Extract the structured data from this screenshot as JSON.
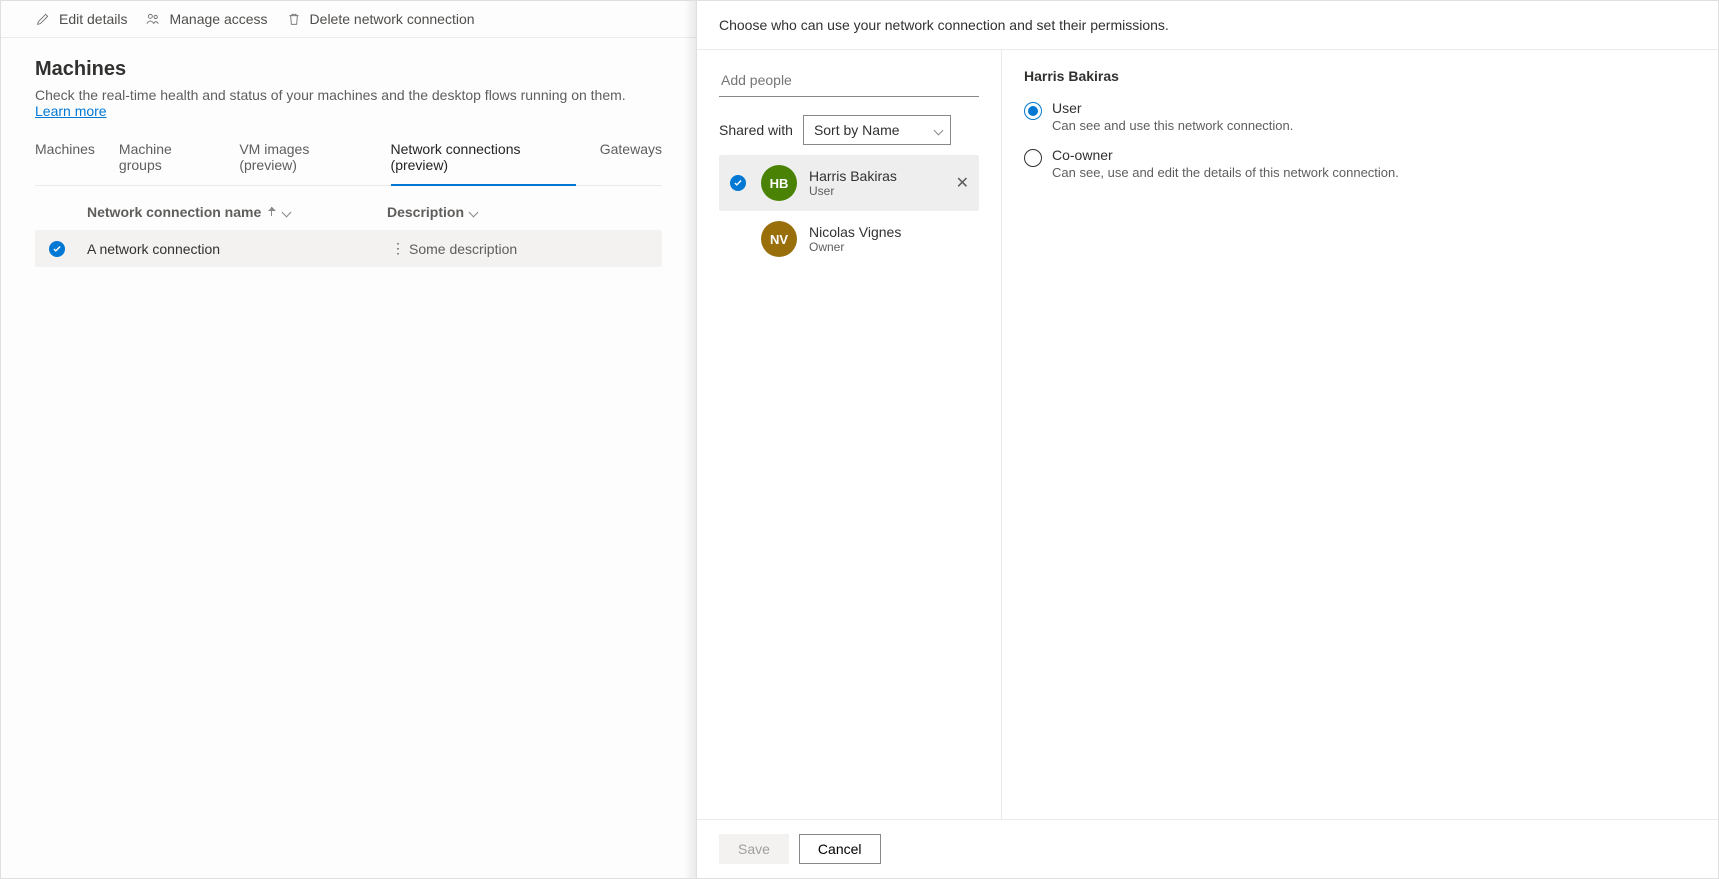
{
  "toolbar": {
    "edit": "Edit details",
    "manage": "Manage access",
    "delete": "Delete network connection"
  },
  "page": {
    "title": "Machines",
    "desc": "Check the real-time health and status of your machines and the desktop flows running on them.",
    "learn": "Learn more"
  },
  "tabs": [
    "Machines",
    "Machine groups",
    "VM images (preview)",
    "Network connections (preview)",
    "Gateways"
  ],
  "cols": {
    "name": "Network connection name",
    "desc": "Description"
  },
  "row": {
    "name": "A network connection",
    "desc": "Some description"
  },
  "panel": {
    "head": "Choose who can use your network connection and set their permissions.",
    "add_placeholder": "Add people",
    "shared_with": "Shared with",
    "sort": "Sort by Name",
    "people": [
      {
        "initials": "HB",
        "name": "Harris Bakiras",
        "role": "User",
        "selected": true
      },
      {
        "initials": "NV",
        "name": "Nicolas Vignes",
        "role": "Owner",
        "selected": false
      }
    ],
    "right_title": "Harris Bakiras",
    "perms": [
      {
        "label": "User",
        "desc": "Can see and use this network connection.",
        "checked": true
      },
      {
        "label": "Co-owner",
        "desc": "Can see, use and edit the details of this network connection.",
        "checked": false
      }
    ],
    "save": "Save",
    "cancel": "Cancel"
  }
}
